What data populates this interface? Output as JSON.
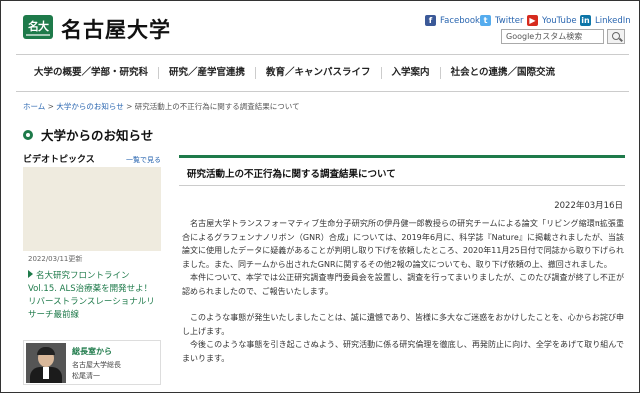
{
  "header": {
    "logo_mark": "名大",
    "logo_text": "名古屋大学",
    "social": [
      {
        "icon": "facebook-icon",
        "glyph": "f",
        "label": "Facebook"
      },
      {
        "icon": "twitter-icon",
        "glyph": "t",
        "label": "Twitter"
      },
      {
        "icon": "youtube-icon",
        "glyph": "▶",
        "label": "YouTube"
      },
      {
        "icon": "linkedin-icon",
        "glyph": "in",
        "label": "LinkedIn"
      }
    ],
    "search_placeholder": "Googleカスタム検索"
  },
  "nav": {
    "items": [
      {
        "label": "大学の概要／学部・研究科"
      },
      {
        "label": "研究／産学官連携"
      },
      {
        "label": "教育／キャンパスライフ"
      },
      {
        "label": "入学案内"
      },
      {
        "label": "社会との連携／国際交流"
      }
    ]
  },
  "breadcrumb": {
    "home": "ホーム",
    "sep": ">",
    "parent": "大学からのお知らせ",
    "current": "研究活動上の不正行為に関する調査結果について"
  },
  "page_title": "大学からのお知らせ",
  "sidebar": {
    "title": "ビデオトピックス",
    "more": "一覧で見る",
    "date": "2022/03/11更新",
    "link": "名大研究フロントライン Vol.15. ALS治療薬を開発せよ！ リバーストランスレーショナルリサーチ最前線",
    "president": {
      "label": "総長室から",
      "role": "名古屋大学総長",
      "name": "松尾清一"
    }
  },
  "article": {
    "title": "研究活動上の不正行為に関する調査結果について",
    "date": "2022年03月16日",
    "paragraphs": [
      "名古屋大学トランスフォーマティブ生命分子研究所の伊丹健一郎教授らの研究チームによる論文「リビング縮環π拡張重合によるグラフェンナノリボン（GNR）合成」については、2019年6月に、科学誌『Nature』に掲載されましたが、当該論文に使用したデータに疑義があることが判明し取り下げを依頼したところ、2020年11月25日付で同誌から取り下げられました。また、同チームから出されたGNRに関するその他2報の論文についても、取り下げ依頼の上、撤回されました。",
      "本件について、本学では公正研究調査専門委員会を設置し、調査を行ってまいりましたが、このたび調査が終了し不正が認められましたので、ご報告いたします。",
      "このような事態が発生いたしましたことは、誠に遺憾であり、皆様に多大なご迷惑をおかけしたことを、心からお詫び申し上げます。",
      "今後このような事態を引き起こさぬよう、研究活動に係る研究倫理を徹底し、再発防止に向け、全学をあげて取り組んでまいります。"
    ]
  }
}
